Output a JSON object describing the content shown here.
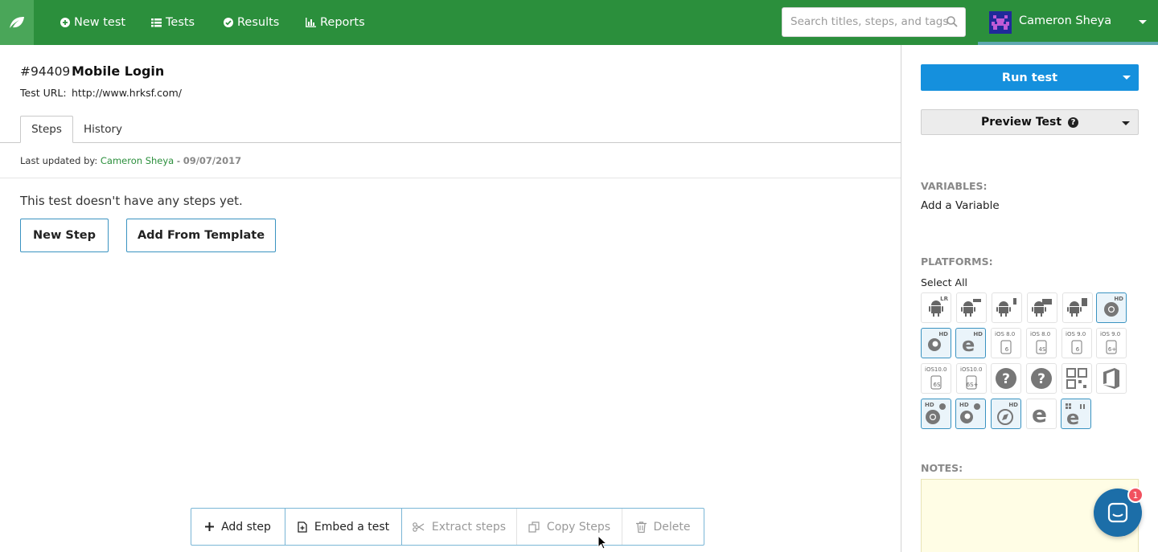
{
  "nav": {
    "new_test": "New test",
    "tests": "Tests",
    "results": "Results",
    "reports": "Reports",
    "search_placeholder": "Search titles, steps, and tags",
    "user_name": "Cameron Sheya",
    "brand_color": "#2b8f3c"
  },
  "test": {
    "id": "#94409",
    "title": "Mobile Login",
    "url_label": "Test URL:",
    "url": "http://www.hrksf.com/"
  },
  "tabs": [
    {
      "label": "Steps",
      "active": true
    },
    {
      "label": "History",
      "active": false
    }
  ],
  "updated": {
    "prefix": "Last updated by:",
    "who": "Cameron Sheya",
    "dash": "-",
    "date": "09/07/2017"
  },
  "steps": {
    "empty_message": "This test doesn't have any steps yet.",
    "new_step": "New Step",
    "add_template": "Add From Template"
  },
  "toolbar": {
    "add_step": "Add step",
    "embed": "Embed a test",
    "extract": "Extract steps",
    "copy": "Copy Steps",
    "delete": "Delete"
  },
  "sidebar": {
    "run_test": "Run test",
    "preview_test": "Preview Test",
    "help_glyph": "?",
    "variables_label": "VARIABLES:",
    "add_variable": "Add a Variable",
    "platforms_label": "PLATFORMS:",
    "select_all": "Select All",
    "notes_label": "NOTES:",
    "accent_color": "#1590dd"
  },
  "platforms": [
    {
      "icon": "android-icon",
      "tag": "LR",
      "selected": false
    },
    {
      "icon": "android-icon",
      "tag": "",
      "selected": false
    },
    {
      "icon": "android-icon",
      "tag": "",
      "selected": false
    },
    {
      "icon": "android-icon",
      "tag": "",
      "selected": false
    },
    {
      "icon": "android-icon",
      "tag": "",
      "selected": false
    },
    {
      "icon": "chrome-icon",
      "tag": "HD",
      "selected": true
    },
    {
      "icon": "firefox-icon",
      "tag": "HD",
      "selected": true
    },
    {
      "icon": "ie-icon",
      "tag": "HD",
      "selected": true
    },
    {
      "icon": "ios-device-icon",
      "tag": "iOS 8.0",
      "sub": "6",
      "selected": false
    },
    {
      "icon": "ios-device-icon",
      "tag": "iOS 8.0",
      "sub": "4S",
      "selected": false
    },
    {
      "icon": "ios-device-icon",
      "tag": "iOS 9.0",
      "sub": "6",
      "selected": false
    },
    {
      "icon": "ios-device-icon",
      "tag": "iOS 9.0",
      "sub": "6+",
      "selected": false
    },
    {
      "icon": "ios-device-icon",
      "tag": "iOS10.0",
      "sub": "6S",
      "selected": false
    },
    {
      "icon": "ios-device-icon",
      "tag": "iOS10.0",
      "sub": "6S+",
      "selected": false
    },
    {
      "icon": "unknown-icon",
      "tag": "",
      "selected": false
    },
    {
      "icon": "unknown-icon",
      "tag": "",
      "selected": false
    },
    {
      "icon": "qr-icon",
      "tag": "",
      "selected": false
    },
    {
      "icon": "office-icon",
      "tag": "",
      "selected": false
    },
    {
      "icon": "chrome-mac-icon",
      "tag": "HD",
      "selected": true
    },
    {
      "icon": "firefox-mac-icon",
      "tag": "HD",
      "selected": true
    },
    {
      "icon": "safari-icon",
      "tag": "HD",
      "selected": true
    },
    {
      "icon": "edge-icon",
      "tag": "",
      "selected": false
    },
    {
      "icon": "ie-windows-icon",
      "tag": "",
      "selected": true
    }
  ],
  "chat": {
    "badge": "1"
  }
}
